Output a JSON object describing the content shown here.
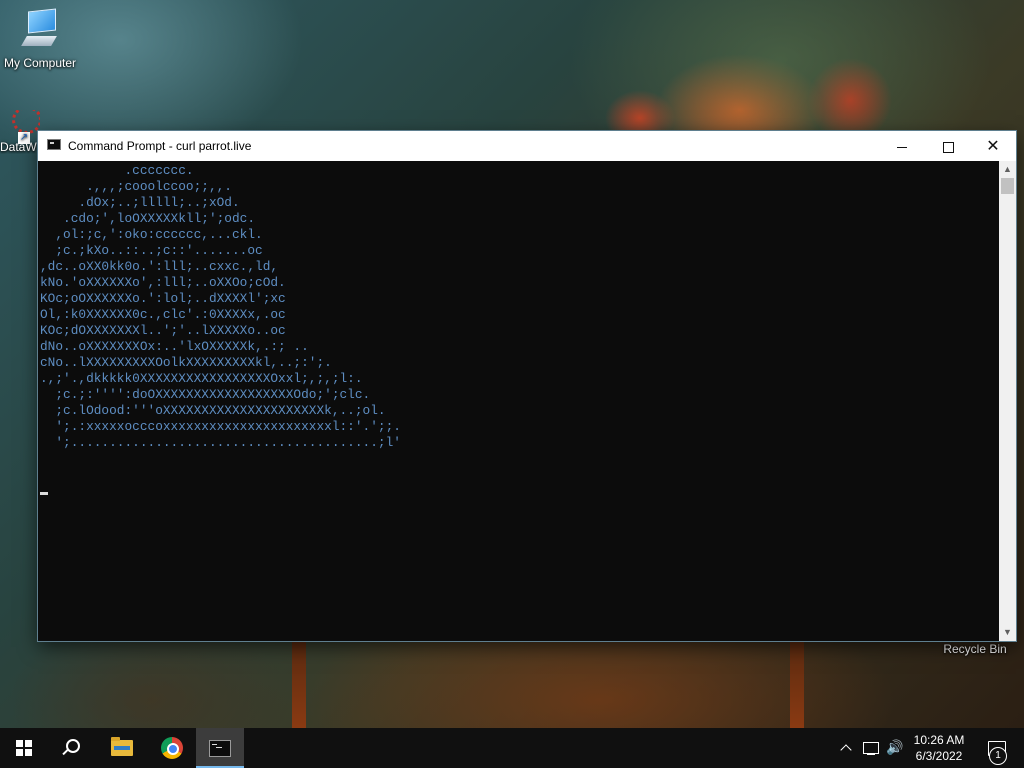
{
  "desktop": {
    "icons": [
      {
        "label": "My Computer",
        "icon": "computer-icon"
      },
      {
        "label": "DataW",
        "icon": "datawrapper-shortcut-icon"
      },
      {
        "label": "Recycle Bin",
        "icon": "recycle-bin-icon"
      }
    ]
  },
  "window": {
    "title": "Command Prompt - curl  parrot.live",
    "icon": "cmd-icon",
    "controls": {
      "minimize": "minimize-icon",
      "maximize": "maximize-icon",
      "close": "close-icon"
    },
    "console_color": "#5e8ec3",
    "console_lines": [
      "           .ccccccc.",
      "      .,,,;cooolccoo;;,,.",
      "     .dOx;..;lllll;..;xOd.",
      "   .cdo;',loOXXXXXkll;';odc.",
      "  ,ol:;c,':oko:cccccc,...ckl.",
      "  ;c.;kXo..::..;c::'.......oc",
      ",dc..oXX0kk0o.':lll;..cxxc.,ld,",
      "kNo.'oXXXXXXo',:lll;..oXXOo;cOd.",
      "KOc;oOXXXXXXo.':lol;..dXXXXl';xc",
      "Ol,:k0XXXXXX0c.,clc'.:0XXXXx,.oc",
      "KOc;dOXXXXXXXl..';'..lXXXXXo..oc",
      "dNo..oXXXXXXXOx:..'lxOXXXXXk,.:; ..",
      "cNo..lXXXXXXXXXOolkXXXXXXXXXkl,..;:';.",
      ".,;'.,dkkkkk0XXXXXXXXXXXXXXXXXOxxl;,;,;l:.",
      "  ;c.;:'''':doOXXXXXXXXXXXXXXXXXXOdo;';clc.",
      "  ;c.lOdood:'''oXXXXXXXXXXXXXXXXXXXXXk,..;ol.",
      "  ';.:xxxxxocccoxxxxxxxxxxxxxxxxxxxxxxl::'.';;.",
      "  ';........................................;l'"
    ]
  },
  "taskbar": {
    "items": [
      {
        "name": "start",
        "icon": "windows-logo-icon"
      },
      {
        "name": "search",
        "icon": "search-icon"
      },
      {
        "name": "file-explorer",
        "icon": "folder-icon"
      },
      {
        "name": "chrome",
        "icon": "chrome-icon"
      },
      {
        "name": "command-prompt",
        "icon": "cmd-icon",
        "active": true
      }
    ],
    "tray": {
      "time": "10:26 AM",
      "date": "6/3/2022",
      "notification_count": "1",
      "icons": [
        "chevron-up-icon",
        "network-icon",
        "volume-icon",
        "notification-icon"
      ]
    }
  }
}
